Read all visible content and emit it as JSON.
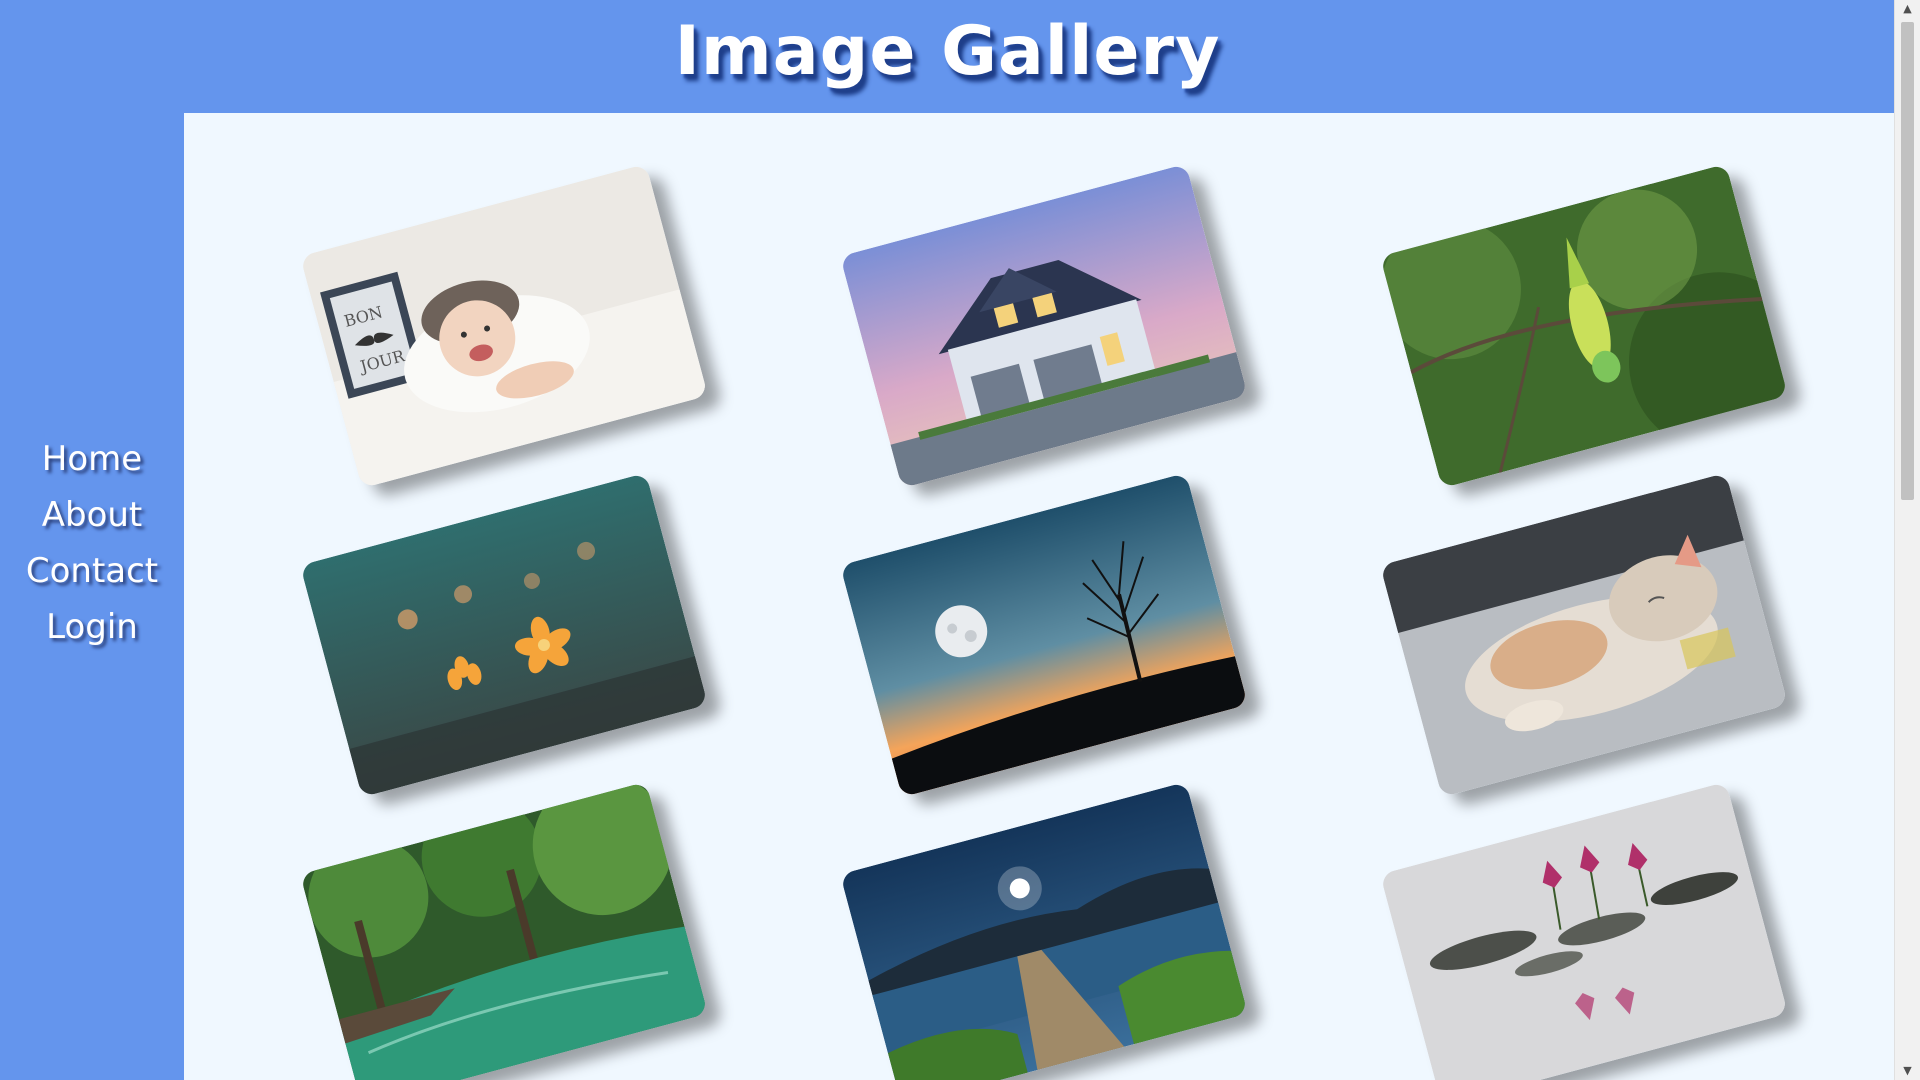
{
  "header": {
    "title": "Image Gallery"
  },
  "nav": {
    "items": [
      {
        "label": "Home"
      },
      {
        "label": "About"
      },
      {
        "label": "Contact"
      },
      {
        "label": "Login"
      }
    ]
  },
  "gallery": {
    "images": [
      {
        "subject": "baby"
      },
      {
        "subject": "house"
      },
      {
        "subject": "parrot"
      },
      {
        "subject": "flowers"
      },
      {
        "subject": "moon-tree"
      },
      {
        "subject": "sleeping-cat"
      },
      {
        "subject": "forest-stream"
      },
      {
        "subject": "lake-pier"
      },
      {
        "subject": "water-lilies"
      }
    ]
  },
  "colors": {
    "page_bg": "#6495ed",
    "content_bg": "#f0f8ff",
    "text": "#ffffff"
  },
  "icons": {
    "scroll_up": "triangle-up-icon",
    "scroll_down": "triangle-down-icon"
  }
}
